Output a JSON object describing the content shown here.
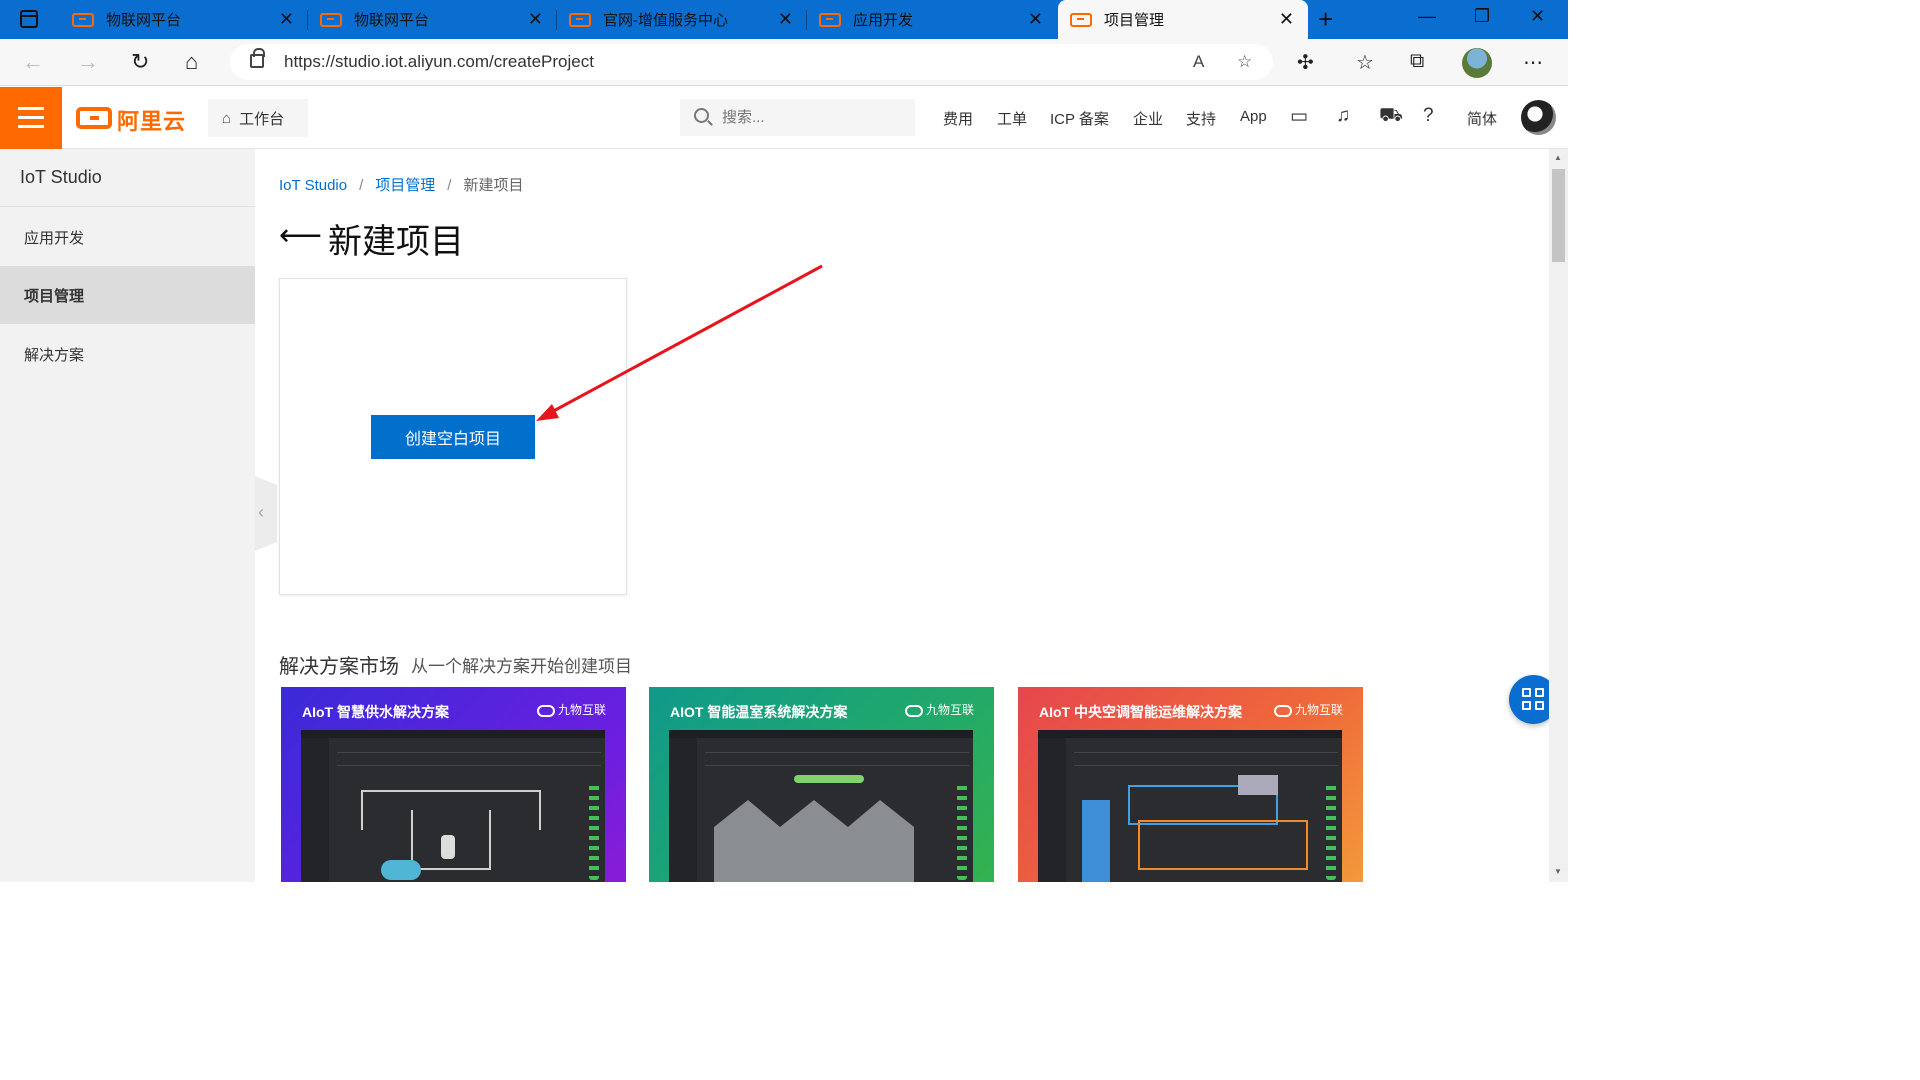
{
  "browser": {
    "tabs": [
      {
        "title": "物联网平台",
        "active": false
      },
      {
        "title": "物联网平台",
        "active": false
      },
      {
        "title": "官网-增值服务中心",
        "active": false
      },
      {
        "title": "应用开发",
        "active": false
      },
      {
        "title": "项目管理",
        "active": true
      }
    ],
    "url": "https://studio.iot.aliyun.com/createProject"
  },
  "topnav": {
    "logo": "阿里云",
    "workbench": "工作台",
    "search_placeholder": "搜索...",
    "links": [
      "费用",
      "工单",
      "ICP 备案",
      "企业",
      "支持",
      "App"
    ],
    "language": "简体"
  },
  "sidebar": {
    "title": "IoT Studio",
    "items": [
      {
        "label": "应用开发",
        "active": false
      },
      {
        "label": "项目管理",
        "active": true
      },
      {
        "label": "解决方案",
        "active": false
      }
    ]
  },
  "main": {
    "breadcrumb": [
      "IoT Studio",
      "项目管理",
      "新建项目"
    ],
    "page_title": "新建项目",
    "create_button": "创建空白项目",
    "market": {
      "title": "解决方案市场",
      "subtitle": "从一个解决方案开始创建项目",
      "cards": [
        {
          "title": "AIoT 智慧供水解决方案",
          "brand": "九物互联"
        },
        {
          "title": "AIOT 智能温室系统解决方案",
          "brand": "九物互联"
        },
        {
          "title": "AIoT 中央空调智能运维解决方案",
          "brand": "九物互联"
        }
      ]
    }
  },
  "colors": {
    "brand_orange": "#ff6a00",
    "primary_blue": "#0070cc",
    "annotation_red": "#e8141b"
  }
}
